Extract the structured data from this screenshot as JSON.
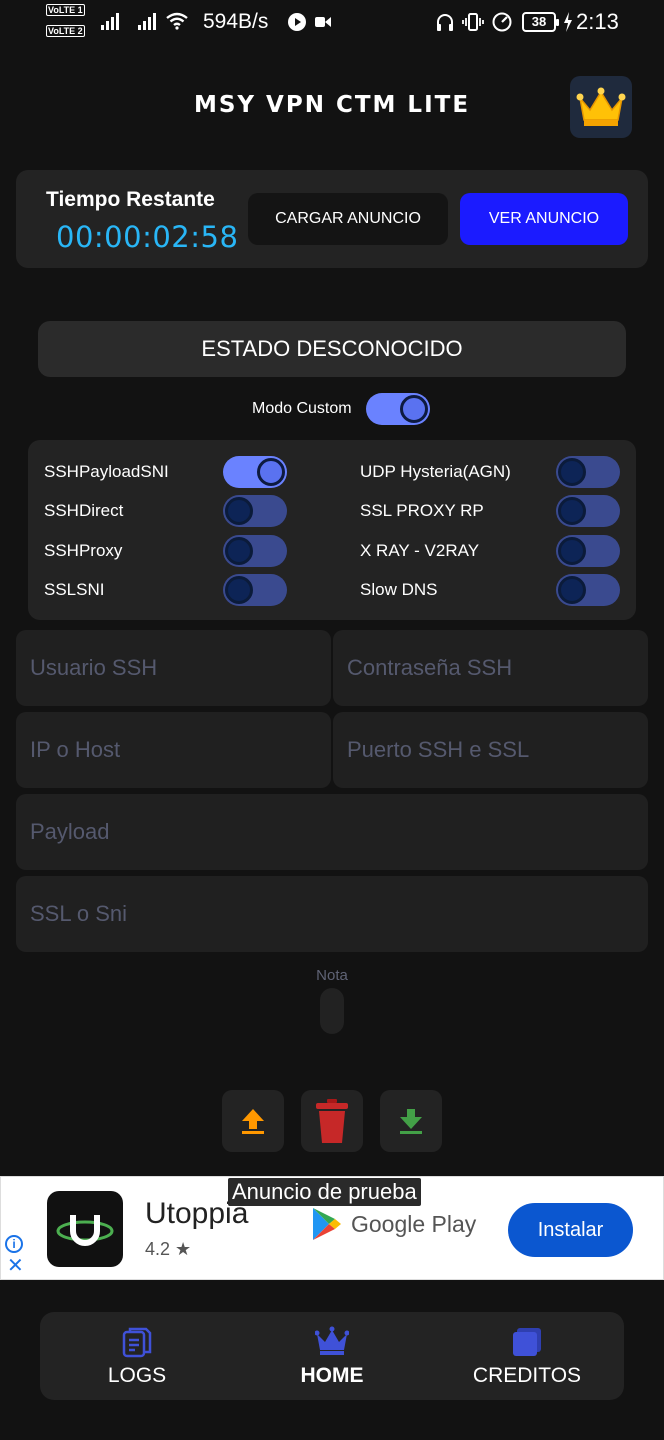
{
  "status_bar": {
    "sim1": "VoLTE 1",
    "sim2": "VoLTE 2",
    "network_speed": "594B/s",
    "battery": "38",
    "time": "2:13"
  },
  "header": {
    "title": "MSY VPN CTM LITE",
    "premium_icon": "crown-icon"
  },
  "timer": {
    "label": "Tiempo Restante",
    "value": "00:00:02:58",
    "load_ad_label": "CARGAR ANUNCIO",
    "watch_ad_label": "VER ANUNCIO"
  },
  "status": {
    "text": "ESTADO DESCONOCIDO"
  },
  "custom_mode": {
    "label": "Modo Custom",
    "on": true
  },
  "modes": [
    {
      "label": "SSHPayloadSNI",
      "on": true
    },
    {
      "label": "SSHDirect",
      "on": false
    },
    {
      "label": "SSHProxy",
      "on": false
    },
    {
      "label": "SSLSNI",
      "on": false
    },
    {
      "label": "UDP Hysteria(AGN)",
      "on": false
    },
    {
      "label": "SSL PROXY RP",
      "on": false
    },
    {
      "label": "X RAY - V2RAY",
      "on": false
    },
    {
      "label": "Slow DNS",
      "on": false
    }
  ],
  "fields": {
    "user": {
      "placeholder": "Usuario SSH",
      "value": ""
    },
    "password": {
      "placeholder": "Contraseña SSH",
      "value": ""
    },
    "host": {
      "placeholder": "IP o Host",
      "value": ""
    },
    "port": {
      "placeholder": "Puerto SSH e SSL",
      "value": ""
    },
    "payload": {
      "placeholder": "Payload",
      "value": ""
    },
    "sni": {
      "placeholder": "SSL o Sni",
      "value": ""
    }
  },
  "note": {
    "label": "Nota"
  },
  "actions": {
    "upload_icon": "upload-icon",
    "delete_icon": "trash-icon",
    "download_icon": "download-icon"
  },
  "ad": {
    "tag": "Anuncio de prueba",
    "app_name": "Utoppia",
    "rating": "4.2 ★",
    "store": "Google Play",
    "install_label": "Instalar"
  },
  "nav": {
    "logs": "LOGS",
    "home": "HOME",
    "credits": "CREDITOS",
    "active": "home"
  },
  "colors": {
    "background": "#121212",
    "card": "#232323",
    "accent_blue": "#1b1bff",
    "timer_cyan": "#29b6f6",
    "toggle_on": "#6a82ff",
    "nav_icon": "#3f51d8"
  }
}
